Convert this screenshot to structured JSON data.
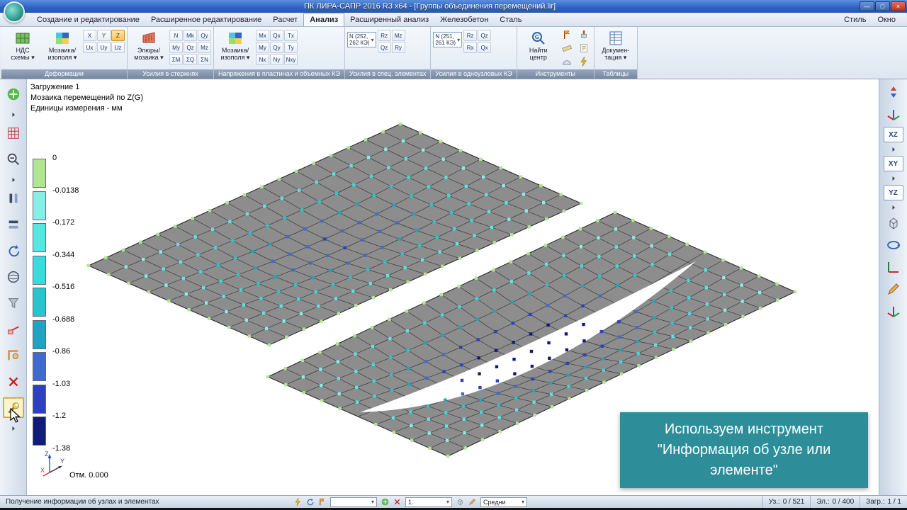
{
  "window": {
    "title": "ПК ЛИРА-САПР  2016 R3 x64 - [Группы объединения перемещений.lir]",
    "controls": [
      {
        "glyph": "—",
        "name": "minimize-button"
      },
      {
        "glyph": "□",
        "name": "maximize-button"
      },
      {
        "glyph": "×",
        "name": "close-button"
      }
    ]
  },
  "menu": {
    "tabs": [
      {
        "label": "Создание и редактирование",
        "active": false
      },
      {
        "label": "Расширенное редактирование",
        "active": false
      },
      {
        "label": "Расчет",
        "active": false
      },
      {
        "label": "Анализ",
        "active": true
      },
      {
        "label": "Расширенный анализ",
        "active": false
      },
      {
        "label": "Железобетон",
        "active": false
      },
      {
        "label": "Сталь",
        "active": false
      }
    ],
    "right": [
      {
        "label": "Стиль"
      },
      {
        "label": "Окно"
      }
    ]
  },
  "ribbon": {
    "groups": [
      {
        "label": "Деформации",
        "items": [
          {
            "type": "big",
            "name": "nds-schemes-button",
            "icon": "nds-icon",
            "lines": [
              "НДС",
              "схемы ▾"
            ]
          },
          {
            "type": "big",
            "name": "mosaic-isofields-button",
            "icon": "mosaic-icon",
            "lines": [
              "Мозаика/",
              "изополя ▾"
            ]
          },
          {
            "type": "grid",
            "name": "displacement-axis-buttons",
            "active": "Z",
            "rows": [
              [
                "X",
                "Y",
                "Z"
              ],
              [
                "Ux",
                "Uy",
                "Uz"
              ]
            ]
          }
        ]
      },
      {
        "label": "Усилия в стержнях",
        "items": [
          {
            "type": "big",
            "name": "epure-mosaic-button",
            "icon": "epure-icon",
            "lines": [
              "Эпюры/",
              "мозаика ▾"
            ]
          },
          {
            "type": "grid",
            "name": "bar-force-buttons",
            "rows": [
              [
                "N",
                "Mk",
                "Qy"
              ],
              [
                "My",
                "Qz",
                "Mz"
              ],
              [
                "ΣM",
                "ΣQ",
                "ΣN"
              ]
            ]
          }
        ]
      },
      {
        "label": "Напряжения в пластинах и объемных КЭ",
        "items": [
          {
            "type": "big",
            "name": "plate-mosaic-isofields-button",
            "icon": "mosaic-icon",
            "lines": [
              "Мозаика/",
              "изополя ▾"
            ]
          },
          {
            "type": "grid",
            "name": "plate-stress-buttons",
            "rows": [
              [
                "Mx",
                "Qx",
                "Tx"
              ],
              [
                "My",
                "Qy",
                "Ty"
              ],
              [
                "Nx",
                "Ny",
                "Nxy"
              ]
            ]
          }
        ]
      },
      {
        "label": "Усилия в спец. элементах",
        "items": [
          {
            "type": "combo",
            "name": "special-element-force-combo",
            "lines": [
              "N (252,",
              "262 КЭ)"
            ]
          },
          {
            "type": "grid",
            "name": "special-element-buttons",
            "rows": [
              [
                "Rz",
                "Mz"
              ],
              [
                "Qz",
                "Ry"
              ]
            ]
          }
        ]
      },
      {
        "label": "Усилия в одноузловых КЭ",
        "items": [
          {
            "type": "combo",
            "name": "single-node-force-combo",
            "lines": [
              "N (251,",
              "261 КЭ)"
            ]
          },
          {
            "type": "grid",
            "name": "single-node-buttons",
            "rows": [
              [
                "Rz",
                "Qz"
              ],
              [
                "Rx",
                "Qx"
              ]
            ]
          }
        ]
      },
      {
        "label": "Инструменты",
        "items": [
          {
            "type": "big",
            "name": "find-center-button",
            "icon": "find-center-icon",
            "lines": [
              "Найти",
              "центр"
            ]
          },
          {
            "type": "iconstack",
            "name": "tools-stack-1",
            "icons": [
              "flag-icon",
              "ruler-icon",
              "protractor-icon"
            ]
          },
          {
            "type": "iconstack",
            "name": "tools-stack-2",
            "icons": [
              "paint-icon",
              "memo-icon",
              "lightning-icon"
            ]
          }
        ]
      },
      {
        "label": "Таблицы",
        "items": [
          {
            "type": "big",
            "name": "documentation-button",
            "icon": "doc-icon",
            "lines": [
              "Докумен-",
              "тация ▾"
            ]
          }
        ]
      }
    ]
  },
  "left_toolbar": {
    "items": [
      {
        "icon": "pan-icon",
        "name": "pan-tool"
      },
      {
        "icon": "arrow-right-icon",
        "name": "expand-arrow-1",
        "small": true
      },
      {
        "icon": "grid-red-icon",
        "name": "mesh-display-tool"
      },
      {
        "icon": "zoom-out-icon",
        "name": "zoom-out-tool"
      },
      {
        "icon": "arrow-right-icon",
        "name": "expand-arrow-2",
        "small": true
      },
      {
        "icon": "flip-vert-icon",
        "name": "projection-tool-1"
      },
      {
        "icon": "flip-horz-icon",
        "name": "projection-tool-2"
      },
      {
        "icon": "rotate-icon",
        "name": "rotate-model-tool"
      },
      {
        "icon": "sphere-icon",
        "name": "sphere-view-tool"
      },
      {
        "icon": "filter-icon",
        "name": "filter-tool"
      },
      {
        "icon": "section-icon",
        "name": "section-tool"
      },
      {
        "icon": "clip-icon",
        "name": "clip-plane-tool"
      },
      {
        "icon": "erase-icon",
        "name": "delete-tool"
      },
      {
        "icon": "wrench-icon",
        "name": "node-element-info-tool",
        "selected": true
      },
      {
        "icon": "arrow-right-icon",
        "name": "more-tools-arrow",
        "small": true
      }
    ]
  },
  "right_toolbar": {
    "items": [
      {
        "icon": "updown-icon",
        "name": "flip-view-button"
      },
      {
        "icon": "axes-color-icon",
        "name": "global-axes-button"
      },
      {
        "label": "XZ",
        "name": "view-xz-button"
      },
      {
        "icon": "arrow-right-icon",
        "name": "view-xz-arrow",
        "small": true
      },
      {
        "label": "XY",
        "name": "view-xy-button"
      },
      {
        "icon": "arrow-right-icon",
        "name": "view-xy-arrow",
        "small": true
      },
      {
        "label": "YZ",
        "name": "view-yz-button"
      },
      {
        "icon": "arrow-right-icon",
        "name": "view-yz-arrow",
        "small": true
      },
      {
        "icon": "cube-icon",
        "name": "isometric-view-button"
      },
      {
        "icon": "rotate-view-icon",
        "name": "rotate-view-button"
      },
      {
        "icon": "axes-icon",
        "name": "local-axes-button"
      },
      {
        "icon": "pencil-icon",
        "name": "edit-view-button"
      },
      {
        "icon": "axes-color-icon",
        "name": "ucs-button"
      }
    ]
  },
  "legend": {
    "values": [
      "0",
      "-0.0138",
      "-0.172",
      "-0.344",
      "-0.516",
      "-0.688",
      "-0.86",
      "-1.03",
      "-1.2",
      "-1.38"
    ],
    "colors": [
      "#b0e692",
      "#86efe7",
      "#57e7e3",
      "#3adbdc",
      "#29c4ce",
      "#1fa3c2",
      "#4169d2",
      "#2b41c0",
      "#101b7a"
    ]
  },
  "canvas": {
    "info_lines": [
      "Загружение 1",
      "Мозаика перемещений по Z(G)",
      "Единицы измерения - мм"
    ],
    "axis_labels": [
      "Z",
      "Y",
      "X"
    ],
    "elevation_label": "Отм. 0.000",
    "overlay_lines": [
      "Используем инструмент",
      "\"Информация об узле или",
      "элементе\""
    ],
    "overlay_bg": "#2d8e9a"
  },
  "scene": {
    "plate_fill": "#8d8d8d",
    "line_color": "#3a3a3a",
    "plates": [
      {
        "corners": [
          [
            87,
            263
          ],
          [
            527,
            63
          ],
          [
            782,
            175
          ],
          [
            342,
            375
          ]
        ],
        "nu": 18,
        "nv": 9,
        "amp": 13,
        "cscale": 6.2
      },
      {
        "corners": [
          [
            340,
            420
          ],
          [
            830,
            188
          ],
          [
            1084,
            300
          ],
          [
            594,
            532
          ]
        ],
        "nu": 20,
        "nv": 10,
        "amp": 24,
        "cscale": 8.2,
        "gap": {
          "a": [
            470,
            470
          ],
          "c1": [
            672,
            400
          ],
          "b": [
            944,
            257
          ],
          "c2": [
            700,
            464
          ],
          "width": 9
        }
      }
    ]
  },
  "statusbar": {
    "message": "Получение информации об узлах и элементах",
    "tools": [
      [
        "lightning-icon",
        "rotate-icon",
        "flag-icon"
      ],
      [
        "pan-icon",
        "erase-icon"
      ],
      [
        "cube-icon",
        "pencil-icon"
      ]
    ],
    "combos": [
      {
        "value": "",
        "name": "status-combo-1"
      },
      {
        "value": "1.",
        "name": "status-combo-2"
      },
      {
        "value": "Средни",
        "name": "status-combo-3"
      }
    ],
    "counters": [
      {
        "label": "Уз.:",
        "value": "0 / 521"
      },
      {
        "label": "Эл.:",
        "value": "0 / 400"
      },
      {
        "label": "Загр.:",
        "value": "1 / 1"
      }
    ]
  }
}
